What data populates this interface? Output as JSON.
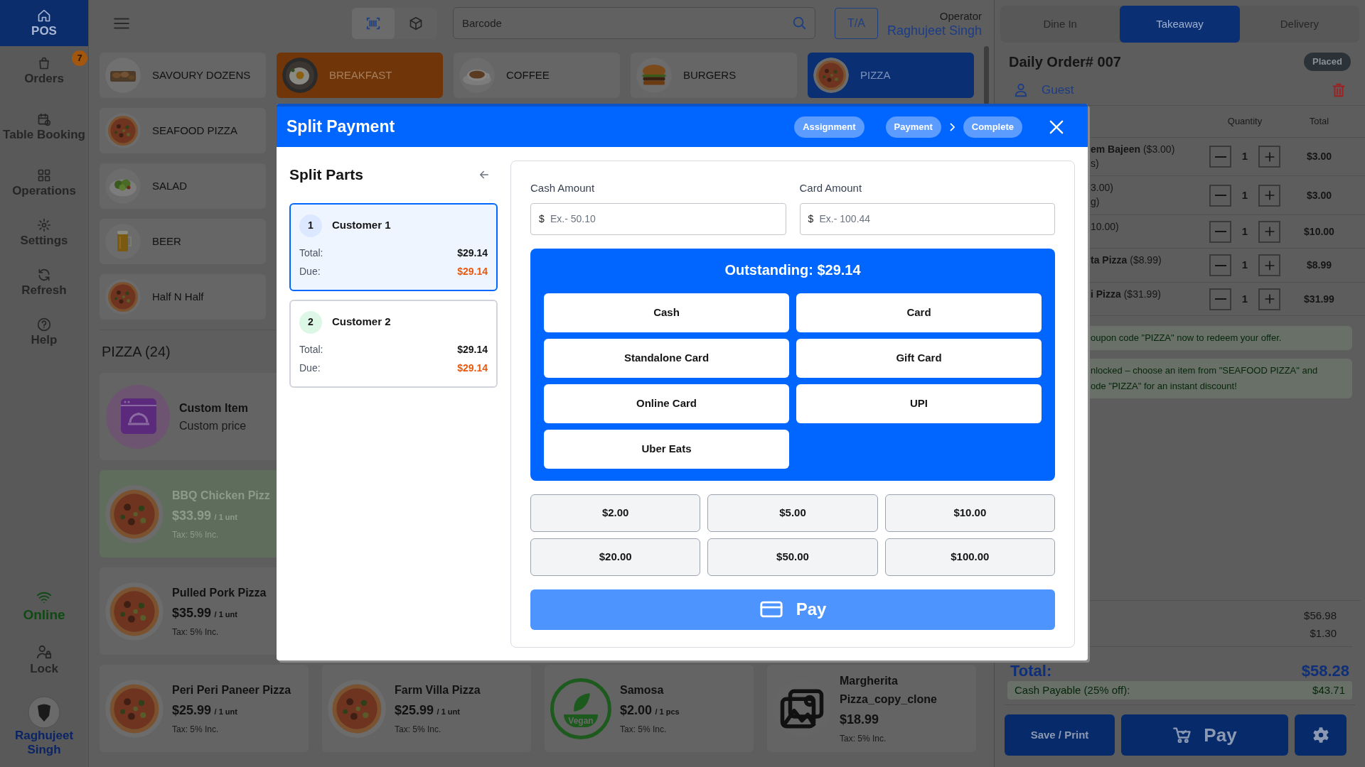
{
  "sidebar": {
    "items": [
      {
        "label": "POS",
        "selected": true
      },
      {
        "label": "Orders",
        "selected": false,
        "badge": "7"
      },
      {
        "label": "Table Booking",
        "selected": false
      },
      {
        "label": "Operations",
        "selected": false
      },
      {
        "label": "Settings",
        "selected": false
      },
      {
        "label": "Refresh",
        "selected": false
      },
      {
        "label": "Help",
        "selected": false
      }
    ],
    "connection": {
      "label": "Online",
      "online": true
    },
    "lock": {
      "label": "Lock"
    },
    "user": {
      "name": "Raghujeet Singh"
    }
  },
  "top_bar": {
    "scan_modes": [
      {
        "selected": true
      },
      {
        "selected": false
      }
    ],
    "search": {
      "placeholder": "Barcode"
    },
    "order_type_button": "T/A",
    "operator": {
      "label": "Operator",
      "name": "Raghujeet Singh"
    }
  },
  "categories": {
    "rows": [
      [
        {
          "label": "SAVOURY DOZENS",
          "selected": false
        },
        {
          "label": "BREAKFAST",
          "selected": false,
          "color": "#703508"
        },
        {
          "label": "COFFEE",
          "selected": false
        },
        {
          "label": "BURGERS",
          "selected": false
        },
        {
          "label": "PIZZA",
          "selected": true
        }
      ],
      [
        {
          "label": "SEAFOOD PIZZA",
          "selected": false
        }
      ],
      [
        {
          "label": "SALAD",
          "selected": false
        }
      ],
      [
        {
          "label": "BEER",
          "selected": false
        }
      ],
      [
        {
          "label": "Half N Half",
          "selected": false
        }
      ]
    ]
  },
  "products": {
    "title": "PIZZA (24)",
    "rows": [
      [
        {
          "kind": "custom",
          "name": "Custom Item",
          "subtitle": "Custom price",
          "unavailable": false
        }
      ],
      [
        {
          "name": "BBQ Chicken Pizz",
          "price": "$33.99",
          "unit": "/ 1 unt",
          "tax": "Tax: 5% Inc.",
          "unavailable": true
        }
      ],
      [
        {
          "name": "Pulled Pork Pizza",
          "price": "$35.99",
          "unit": "/ 1 unt",
          "tax": "Tax: 5% Inc.",
          "unavailable": false
        }
      ],
      [
        {
          "name": "Peri Peri Paneer Pizza",
          "price": "$25.99",
          "unit": "/ 1 unt",
          "tax": "Tax: 5% Inc.",
          "unavailable": false
        },
        {
          "name": "Farm Villa Pizza",
          "price": "$25.99",
          "unit": "/ 1 unt",
          "tax": "Tax: 5% Inc.",
          "unavailable": false
        },
        {
          "kind": "vegan",
          "badge_text": "Vegan",
          "name": "Samosa",
          "price": "$2.00",
          "unit": "/ 1 pcs",
          "tax": "Tax: 5% Inc.",
          "unavailable": false
        },
        {
          "kind": "placeholder",
          "name": "Margherita Pizza_copy_clone",
          "price": "$18.99",
          "tax": "Tax: 5% Inc.",
          "unavailable": false
        }
      ]
    ]
  },
  "order_panel": {
    "tabs": [
      {
        "label": "Dine In",
        "selected": false
      },
      {
        "label": "Takeaway",
        "selected": true
      },
      {
        "label": "Delivery",
        "selected": false
      }
    ],
    "title": "Daily Order# 007",
    "status": "Placed",
    "customer": "Guest",
    "columns": [
      "Quantity",
      "Total"
    ],
    "items": [
      {
        "name": "**em Bajeen** ($3.00)",
        "detail": "s)",
        "quantity": "1",
        "total": "$3.00"
      },
      {
        "name": "3.00)",
        "detail": "g)",
        "quantity": "1",
        "total": "$3.00"
      },
      {
        "name": "10.00)",
        "quantity": "1",
        "total": "$10.00"
      },
      {
        "name": "**ta Pizza** ($8.99)",
        "quantity": "1",
        "total": "$8.99"
      },
      {
        "name": "**i Pizza** ($31.99)",
        "quantity": "1",
        "total": "$31.99"
      }
    ],
    "notes": [
      {
        "lines": [
          "oupon code \"PIZZA\" now to redeem your offer."
        ]
      },
      {
        "lines": [
          "nlocked – choose an item from \"SEAFOOD PIZZA\" and",
          "ode \"PIZZA\" for an instant discount!"
        ]
      }
    ],
    "summary_values": [
      "$56.98",
      "$1.30"
    ],
    "total": {
      "label": "Total:",
      "value": "$58.28"
    },
    "cash_payable": {
      "label": "Cash Payable (25% off):",
      "value": "$43.71"
    },
    "buttons": {
      "save": "Save / Print",
      "pay": "Pay"
    }
  },
  "split_payment": {
    "title": "Split Payment",
    "steps": [
      {
        "label": "Assignment",
        "chevron": false
      },
      {
        "label": "Payment",
        "chevron": false
      },
      {
        "label": "Complete",
        "chevron": true
      }
    ],
    "parts_title": "Split Parts",
    "customers": [
      {
        "number": "1",
        "name": "Customer 1",
        "total_label": "Total:",
        "total": "$29.14",
        "due_label": "Due:",
        "due": "$29.14",
        "selected": true,
        "color": "#dbe8ff"
      },
      {
        "number": "2",
        "name": "Customer 2",
        "total_label": "Total:",
        "total": "$29.14",
        "due_label": "Due:",
        "due": "$29.14",
        "selected": false,
        "color": "#dcf7e6"
      }
    ],
    "cash_amount": {
      "label": "Cash Amount",
      "prefix": "$",
      "placeholder": "Ex.- 50.10"
    },
    "card_amount": {
      "label": "Card Amount",
      "prefix": "$",
      "placeholder": "Ex.- 100.44"
    },
    "outstanding": "Outstanding: $29.14",
    "methods": [
      "Cash",
      "Card",
      "Standalone Card",
      "Gift Card",
      "Online Card",
      "UPI",
      "Uber Eats"
    ],
    "quick_amounts": [
      "$2.00",
      "$5.00",
      "$10.00",
      "$20.00",
      "$50.00",
      "$100.00"
    ],
    "pay_button": "Pay"
  }
}
